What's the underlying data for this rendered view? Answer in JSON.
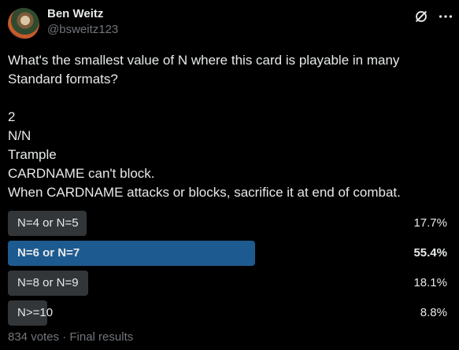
{
  "tweet": {
    "author_name": "Ben Weitz",
    "author_handle": "@bsweitz123",
    "text": "What's the smallest value of N where this card is playable in many Standard formats?\n\n2\nN/N\nTrample\nCARDNAME can't block.\nWhen CARDNAME attacks or blocks, sacrifice it at end of combat."
  },
  "poll": {
    "options": [
      {
        "label": "N=4 or N=5",
        "percent_label": "17.7%",
        "percent": 17.7
      },
      {
        "label": "N=6 or N=7",
        "percent_label": "55.4%",
        "percent": 55.4,
        "winner": true
      },
      {
        "label": "N=8 or N=9",
        "percent_label": "18.1%",
        "percent": 18.1
      },
      {
        "label": "N>=10",
        "percent_label": "8.8%",
        "percent": 8.8
      }
    ],
    "footer": "834 votes · Final results"
  },
  "icons": {
    "header_right": [
      "grok-icon",
      "more-icon"
    ]
  },
  "colors": {
    "background": "#000000",
    "text": "#e7e9ea",
    "muted": "#71767b",
    "bar": "#333639",
    "bar_winner": "#1d5a8f"
  }
}
